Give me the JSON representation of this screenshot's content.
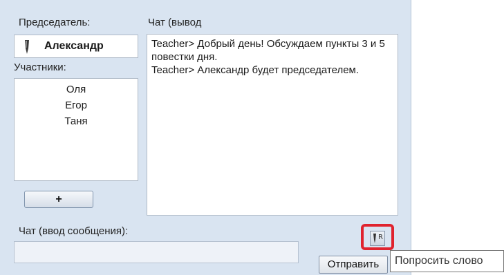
{
  "chair": {
    "label": "Председатель:",
    "name": "Александр"
  },
  "participants": {
    "label": "Участники:",
    "items": [
      "Оля",
      "Егор",
      "Таня"
    ],
    "add_label": "+"
  },
  "chat_output": {
    "label": "Чат (вывод",
    "messages": [
      "Teacher> Добрый день! Обсуждаем пункты 3 и 5 повестки дня.",
      "Teacher> Александр будет председателем."
    ]
  },
  "chat_input": {
    "label": "Чат (ввод сообщения):",
    "value": "",
    "send_label": "Отправить"
  },
  "request_button": {
    "icon": "pen-request-icon",
    "letter": "R"
  },
  "tooltip": {
    "text": "Попросить слово"
  },
  "colors": {
    "window_bg": "#d9e4f1",
    "highlight": "#e0232e"
  }
}
